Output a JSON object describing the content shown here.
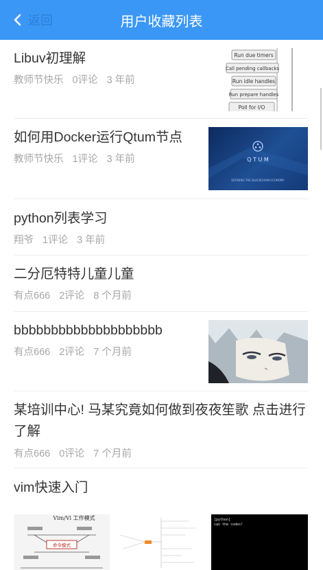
{
  "header": {
    "back_label": "返回",
    "title": "用户收藏列表"
  },
  "items": [
    {
      "title": "Libuv初理解",
      "author": "教师节快乐",
      "comments": "0评论",
      "time": "3 年前",
      "thumb_labels": [
        "Run due timers",
        "Call pending callbacks",
        "Run idle handles",
        "Run prepare handles",
        "Poll for I/O"
      ]
    },
    {
      "title": "如何用Docker运行Qtum节点",
      "author": "教师节快乐",
      "comments": "1评论",
      "time": "3 年前",
      "thumb_brand": "Q T U M",
      "thumb_tagline": "DEFINING THE BLOCKCHAIN ECONOMY"
    },
    {
      "title": "python列表学习",
      "author": "翔爷",
      "comments": "1评论",
      "time": "3 年前"
    },
    {
      "title": "二分厄特特儿童儿童",
      "author": "有点666",
      "comments": "2评论",
      "time": "8 个月前"
    },
    {
      "title": "bbbbbbbbbbbbbbbbbbbb",
      "author": "有点666",
      "comments": "2评论",
      "time": "7 个月前"
    },
    {
      "title": "某培训中心! 马某究竟如何做到夜夜笙歌 点击进行了解",
      "author": "有点666",
      "comments": "0评论",
      "time": "7 个月前"
    },
    {
      "title": "vim快速入门",
      "thumb_title": "Vim/Vi 工作模式",
      "thumb_mode": "命令模式",
      "thumb_terminal": [
        "[python]",
        "can the codes!"
      ]
    }
  ]
}
